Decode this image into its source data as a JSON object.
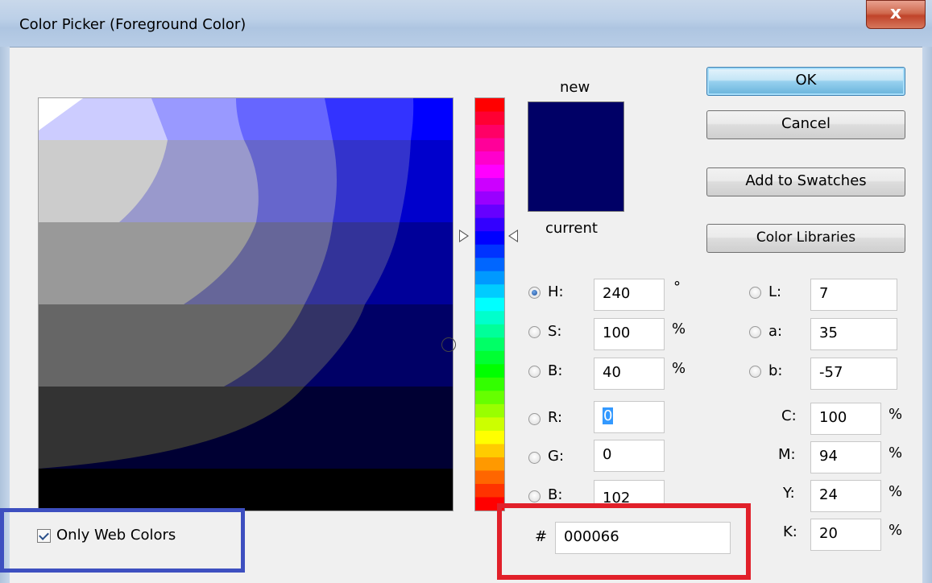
{
  "window": {
    "title": "Color Picker (Foreground Color)",
    "close_glyph": "x"
  },
  "swatch": {
    "new_label": "new",
    "current_label": "current",
    "new_color": "#000066",
    "current_color": "#000066"
  },
  "buttons": {
    "ok": "OK",
    "cancel": "Cancel",
    "add_to_swatches": "Add to Swatches",
    "color_libraries": "Color Libraries"
  },
  "hsb": {
    "h_label": "H:",
    "h_value": "240",
    "h_unit": "°",
    "s_label": "S:",
    "s_value": "100",
    "s_unit": "%",
    "b_label": "B:",
    "b_value": "40",
    "b_unit": "%"
  },
  "rgb": {
    "r_label": "R:",
    "r_value": "0",
    "g_label": "G:",
    "g_value": "0",
    "b_label": "B:",
    "b_value": "102"
  },
  "lab": {
    "l_label": "L:",
    "l_value": "7",
    "a_label": "a:",
    "a_value": "35",
    "b_label": "b:",
    "b_value": "-57"
  },
  "cmyk": {
    "c_label": "C:",
    "c_value": "100",
    "c_unit": "%",
    "m_label": "M:",
    "m_value": "94",
    "m_unit": "%",
    "y_label": "Y:",
    "y_value": "24",
    "y_unit": "%",
    "k_label": "K:",
    "k_value": "20",
    "k_unit": "%"
  },
  "hex": {
    "label": "#",
    "value": "000066"
  },
  "web_colors": {
    "label": "Only Web Colors",
    "checked": true
  },
  "selected_radio": "H",
  "annotation_colors": {
    "blue_box": "#3d4fc0",
    "red_box": "#e1202a"
  }
}
